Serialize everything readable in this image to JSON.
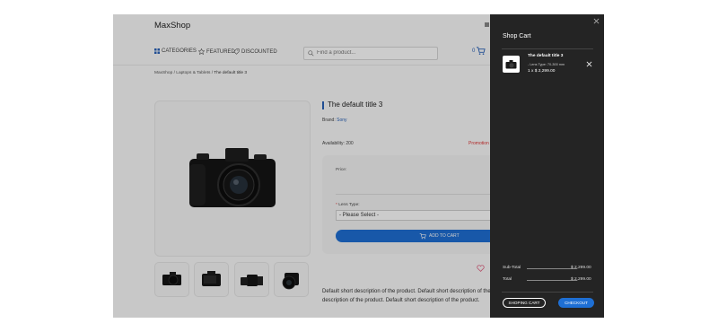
{
  "header": {
    "logo": "MaxShop",
    "nav": {
      "categories": "CATEGORIES",
      "featured": "FEATURED",
      "discounted": "DISCOUNTED"
    },
    "search": {
      "placeholder": "Find a product..."
    },
    "cart_count": "0"
  },
  "breadcrumb": {
    "home": "MaxShop",
    "sep1": "/",
    "category": "Laptops & Tablets",
    "sep2": "/",
    "current": "The default title 3"
  },
  "product": {
    "title": "The default title 3",
    "brand_label": "Brand:",
    "brand_value": "Sony",
    "availability_label": "Availability:",
    "availability_value": "200",
    "promotion": "Promotion",
    "price_label": "Price:",
    "lens_label": "Lens Type:",
    "lens_required_mark": "*",
    "lens_select_value": "- Please Select -",
    "add_to_cart": "ADD TO CART",
    "description_line1": "Default short description of the product. Default short description of the",
    "description_line2": "description of the product. Default short description of the product."
  },
  "cart_panel": {
    "title": "Shop Cart",
    "item": {
      "name": "The default title 3",
      "option": "- Lens Type: 70-300 mm",
      "qty_price": "1 x $ 2,299.00"
    },
    "subtotal_label": "Sub-Total",
    "subtotal_value": "$ 2,299.00",
    "total_label": "Total",
    "total_value": "$ 2,299.00",
    "shopping_cart_button": "SHOPING CART",
    "checkout_button": "CHECKOUT"
  },
  "colors": {
    "accent": "#1e6fd4",
    "panel_bg": "#242424",
    "promotion": "#dd3333"
  },
  "icons": [
    "grid-icon",
    "star-icon",
    "tag-icon",
    "search-icon",
    "cart-icon",
    "heart-icon",
    "close-icon",
    "camera-icon"
  ]
}
